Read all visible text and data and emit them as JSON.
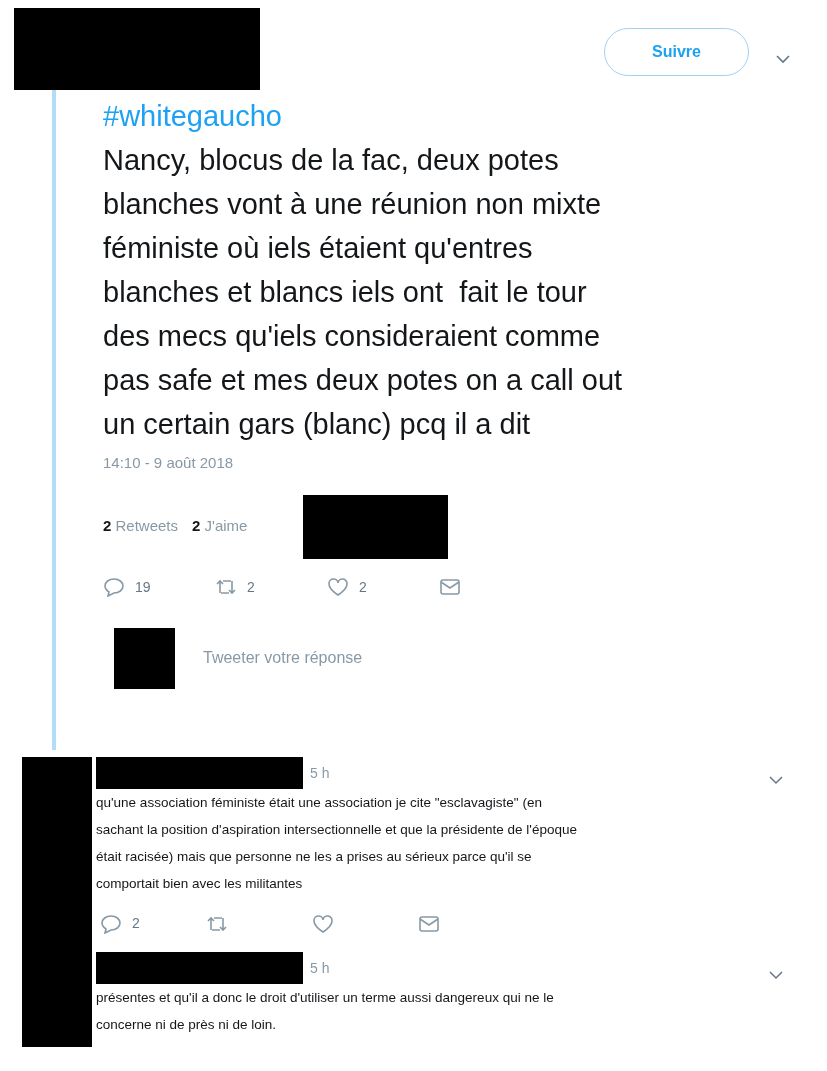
{
  "follow_button": "Suivre",
  "tweet": {
    "hashtag": "#whitegaucho",
    "text_lines": [
      "Nancy, blocus de la fac, deux potes",
      "blanches vont à une réunion non mixte",
      "féministe où iels étaient qu'entres",
      "blanches et blancs iels ont  fait le tour",
      "des mecs qu'iels consideraient comme",
      "pas safe et mes deux potes on a call out",
      "un certain gars (blanc) pcq il a dit"
    ],
    "timestamp": "14:10 - 9 août 2018",
    "stats": [
      {
        "count": "2",
        "label": "Retweets"
      },
      {
        "count": "2",
        "label": "J'aime"
      }
    ],
    "actions": [
      {
        "kind": "reply",
        "count": "19"
      },
      {
        "kind": "retweet",
        "count": "2"
      },
      {
        "kind": "like",
        "count": "2"
      },
      {
        "kind": "message"
      }
    ]
  },
  "reply_box": {
    "placeholder": "Tweeter votre réponse"
  },
  "replies": [
    {
      "time": "5 h",
      "text_lines": [
        "qu'une association féministe était une association je cite \"esclavagiste\" (en",
        "sachant la position d'aspiration intersectionnelle et que la présidente de l'époque",
        "était racisée) mais que personne ne les a prises au sérieux parce qu'il se",
        "comportait bien avec les militantes"
      ],
      "actions": [
        {
          "kind": "reply",
          "count": "2"
        },
        {
          "kind": "retweet"
        },
        {
          "kind": "like"
        },
        {
          "kind": "message"
        }
      ]
    },
    {
      "time": "5 h",
      "text_lines": [
        "présentes et qu'il a donc le droit d'utiliser un terme aussi dangereux qui ne le",
        "concerne ni de près ni de loin."
      ]
    }
  ]
}
